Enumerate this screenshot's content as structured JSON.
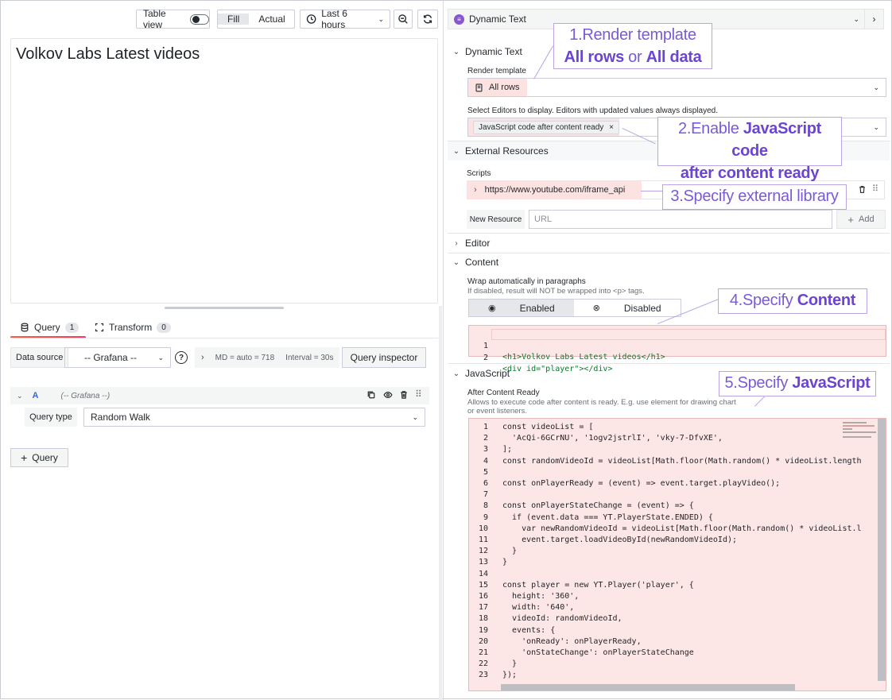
{
  "toolbar": {
    "table_view": "Table view",
    "fill": "Fill",
    "actual": "Actual",
    "time_range": "Last 6 hours"
  },
  "panel": {
    "title": "Volkov Labs Latest videos"
  },
  "query_tabs": {
    "query": "Query",
    "query_count": "1",
    "transform": "Transform",
    "transform_count": "0"
  },
  "datasource": {
    "label": "Data source",
    "value": "-- Grafana --",
    "md": "MD = auto = 718",
    "interval": "Interval = 30s",
    "inspector": "Query inspector"
  },
  "query": {
    "ref": "A",
    "source": "(-- Grafana --)",
    "type_label": "Query type",
    "type_value": "Random Walk",
    "add": "Query"
  },
  "options": {
    "header": "Dynamic Text",
    "dynamic_text": "Dynamic Text",
    "render_label": "Render template",
    "render_value": "All rows",
    "editors_label": "Select Editors to display. Editors with updated values always displayed.",
    "editors_chip": "JavaScript code after content ready",
    "external": "External Resources",
    "scripts_label": "Scripts",
    "script_url": "https://www.youtube.com/iframe_api",
    "new_resource": "New Resource",
    "url_placeholder": "URL",
    "add": "Add",
    "editor": "Editor",
    "content": "Content",
    "wrap_label": "Wrap automatically in paragraphs",
    "wrap_sub": "If disabled, result will NOT be wrapped into <p> tags.",
    "enabled": "Enabled",
    "disabled": "Disabled",
    "javascript": "JavaScript",
    "after_label": "After Content Ready",
    "after_sub1": "Allows to execute code after content is ready. E.g. use element for drawing chart",
    "after_sub2": "or event listeners."
  },
  "content_code": [
    "<h1>Volkov Labs Latest videos</h1>",
    "<div id=\"player\"></div>"
  ],
  "js_code": [
    "const videoList = [",
    "  'AcQi-6GCrNU', '1ogv2jstrlI', 'vky-7-DfvXE',",
    "];",
    "const randomVideoId = videoList[Math.floor(Math.random() * videoList.length",
    "",
    "const onPlayerReady = (event) => event.target.playVideo();",
    "",
    "const onPlayerStateChange = (event) => {",
    "  if (event.data === YT.PlayerState.ENDED) {",
    "    var newRandomVideoId = videoList[Math.floor(Math.random() * videoList.l",
    "    event.target.loadVideoById(newRandomVideoId);",
    "  }",
    "}",
    "",
    "const player = new YT.Player('player', {",
    "  height: '360',",
    "  width: '640',",
    "  videoId: randomVideoId,",
    "  events: {",
    "    'onReady': onPlayerReady,",
    "    'onStateChange': onPlayerStateChange",
    "  }",
    "});"
  ],
  "callouts": {
    "c1_line1": "1.Render template",
    "c1_b1": "All rows",
    "c1_mid": " or ",
    "c1_b2": "All data",
    "c2_pre": "2.Enable ",
    "c2_b": "JavaScript code",
    "c2_line2": "after content ready",
    "c3": "3.Specify external library",
    "c4_pre": "4.Specify ",
    "c4_b": "Content",
    "c5_pre": "5.Specify ",
    "c5_b": "JavaScript"
  },
  "colors": {
    "accent_purple": "#7b5bd5",
    "highlight_red": "#fde2e2",
    "tab_underline": "#f55f3e"
  }
}
